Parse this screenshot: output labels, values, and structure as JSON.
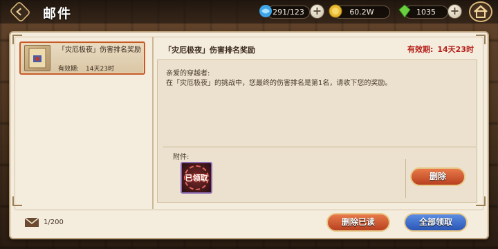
{
  "header": {
    "title": "邮件",
    "resources": [
      {
        "icon": "blue-crystal-icon",
        "value": "291/123"
      },
      {
        "icon": "gold-coin-icon",
        "value": "60.2W"
      },
      {
        "icon": "green-gem-icon",
        "value": "1035"
      }
    ],
    "plus_label": "+"
  },
  "mail_list": [
    {
      "title": "「灾厄极夜」伤害排名奖励",
      "expire_label": "有效期:",
      "expire_value": "14天23时"
    }
  ],
  "detail": {
    "title": "「灾厄极夜」伤害排名奖励",
    "expire_label": "有效期:",
    "expire_value": "14天23时",
    "greeting": "亲爱的穿越者:",
    "body": "在「灾厄极夜」的挑战中，您最终的伤害排名是第1名，请收下您的奖励。",
    "attachment_label": "附件:",
    "attachment_stamp": "已领取",
    "delete_label": "删除"
  },
  "footer": {
    "mail_count": "1/200",
    "delete_read_label": "删除已读",
    "claim_all_label": "全部领取"
  },
  "colors": {
    "accent_red": "#b5211b",
    "button_red": "#c45a2a",
    "button_blue": "#2a56b5"
  }
}
